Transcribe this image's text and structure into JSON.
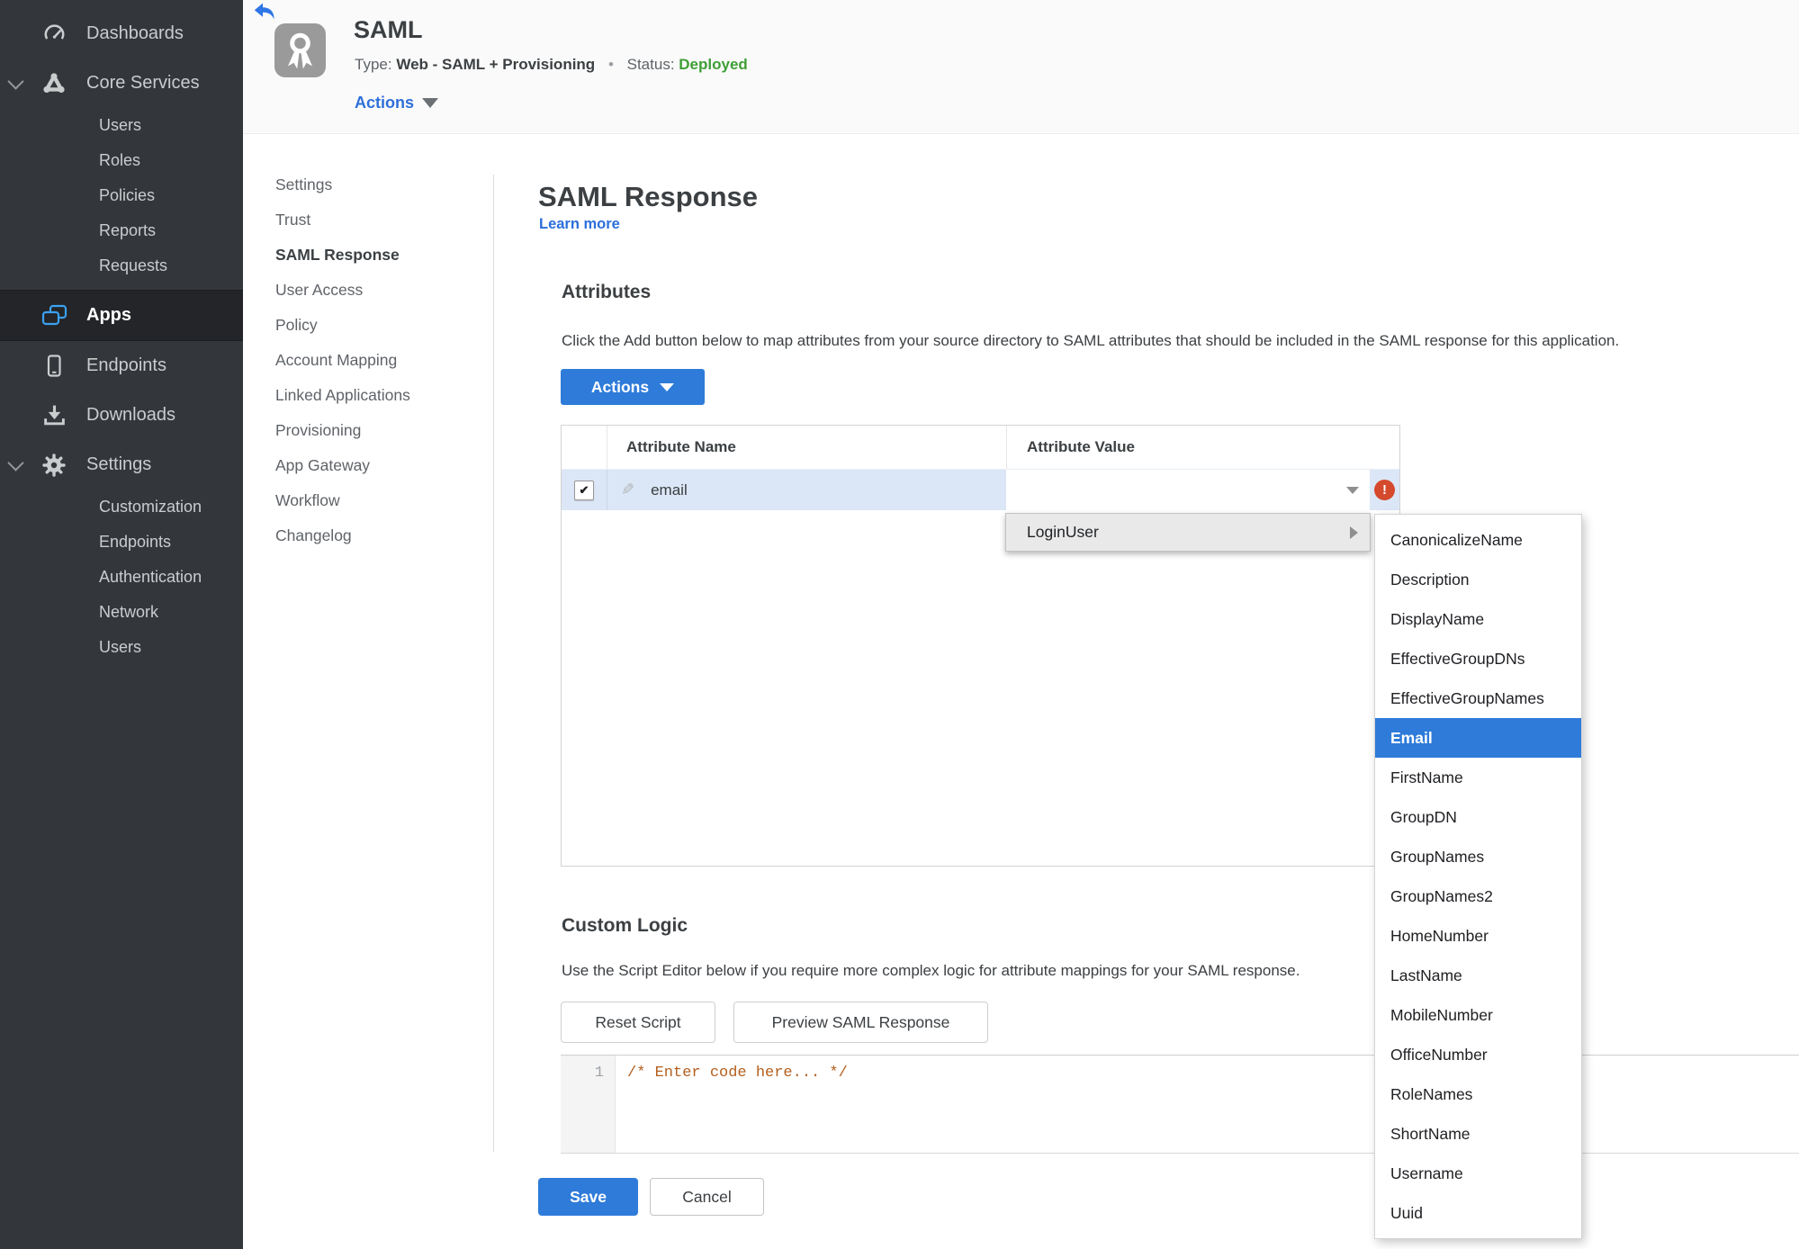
{
  "sidebar": {
    "dashboards": "Dashboards",
    "core_services": "Core Services",
    "core_items": [
      "Users",
      "Roles",
      "Policies",
      "Reports",
      "Requests"
    ],
    "apps": "Apps",
    "endpoints": "Endpoints",
    "downloads": "Downloads",
    "settings": "Settings",
    "settings_items": [
      "Customization",
      "Endpoints",
      "Authentication",
      "Network",
      "Users"
    ]
  },
  "header": {
    "title": "SAML",
    "type_label": "Type:",
    "type_value": "Web - SAML + Provisioning",
    "dot": "•",
    "status_label": "Status:",
    "status_value": "Deployed",
    "actions": "Actions"
  },
  "subnav": [
    "Settings",
    "Trust",
    "SAML Response",
    "User Access",
    "Policy",
    "Account Mapping",
    "Linked Applications",
    "Provisioning",
    "App Gateway",
    "Workflow",
    "Changelog"
  ],
  "content": {
    "title": "SAML Response",
    "learn_more": "Learn more",
    "attributes_heading": "Attributes",
    "attributes_desc": "Click the Add button below to map attributes from your source directory to SAML attributes that should be included in the SAML response for this application.",
    "actions_button": "Actions",
    "col_name": "Attribute Name",
    "col_value": "Attribute Value",
    "row_name": "email",
    "row_value": "",
    "custom_heading": "Custom Logic",
    "custom_desc": "Use the Script Editor below if you require more complex logic for attribute mappings for your SAML response.",
    "reset_button": "Reset Script",
    "preview_button": "Preview SAML Response",
    "line_number": "1",
    "code": "/* Enter code here... */",
    "save": "Save",
    "cancel": "Cancel"
  },
  "menu": {
    "parent": "LoginUser",
    "selected": "Email",
    "items": [
      "CanonicalizeName",
      "Description",
      "DisplayName",
      "EffectiveGroupDNs",
      "EffectiveGroupNames",
      "Email",
      "FirstName",
      "GroupDN",
      "GroupNames",
      "GroupNames2",
      "HomeNumber",
      "LastName",
      "MobileNumber",
      "OfficeNumber",
      "RoleNames",
      "ShortName",
      "Username",
      "Uuid"
    ],
    "colors": {
      "accent_blue": "#2e7bd9",
      "status_green": "#3f9e36",
      "error_red": "#d5492c",
      "row_highlight": "#dbe7f6",
      "code_comment": "#b35f1f",
      "sidebar_bg": "#33373b"
    }
  }
}
